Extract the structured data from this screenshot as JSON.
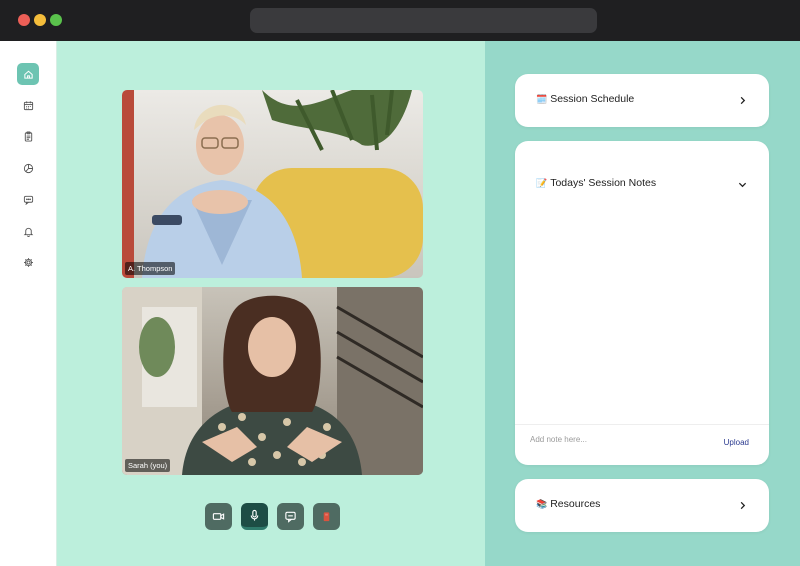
{
  "window": {
    "controls": [
      "close",
      "minimize",
      "maximize"
    ]
  },
  "sidebar": {
    "items": [
      {
        "icon": "home-icon",
        "active": true
      },
      {
        "icon": "calendar-icon",
        "active": false
      },
      {
        "icon": "clipboard-icon",
        "active": false
      },
      {
        "icon": "pie-chart-icon",
        "active": false
      },
      {
        "icon": "chat-icon",
        "active": false
      },
      {
        "icon": "bell-icon",
        "active": false
      },
      {
        "icon": "settings-icon",
        "active": false
      }
    ]
  },
  "video": {
    "participants": [
      {
        "name": "A. Thompson"
      },
      {
        "name": "Sarah (you)"
      }
    ],
    "controls": [
      {
        "icon": "camera-icon"
      },
      {
        "icon": "microphone-icon"
      },
      {
        "icon": "chat-bubble-icon"
      },
      {
        "icon": "end-call-icon"
      }
    ]
  },
  "panel": {
    "schedule": {
      "emoji": "🗓️",
      "title": "Session Schedule"
    },
    "notes": {
      "emoji": "📝",
      "title": "Todays' Session Notes",
      "input_placeholder": "Add note here...",
      "upload_label": "Upload"
    },
    "resources": {
      "emoji": "📚",
      "title": "Resources"
    }
  },
  "colors": {
    "stage_bg": "#bcefdc",
    "panel_bg": "#96d8c9",
    "accent": "#6dc4b2",
    "control_dark": "#4f6b62",
    "control_active": "#1d4d45",
    "end_call": "#d9533f"
  }
}
